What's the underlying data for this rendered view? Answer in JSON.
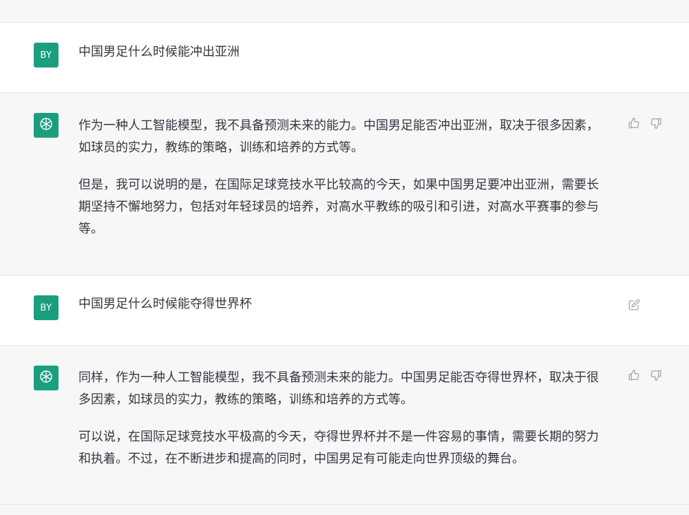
{
  "messages": [
    {
      "role": "user",
      "avatar_initials": "BY",
      "text": "中国男足什么时候能冲出亚洲"
    },
    {
      "role": "assistant",
      "paragraphs": [
        "作为一种人工智能模型，我不具备预测未来的能力。中国男足能否冲出亚洲，取决于很多因素，如球员的实力，教练的策略，训练和培养的方式等。",
        "但是，我可以说明的是，在国际足球竞技水平比较高的今天，如果中国男足要冲出亚洲，需要长期坚持不懈地努力，包括对年轻球员的培养，对高水平教练的吸引和引进，对高水平赛事的参与等。"
      ]
    },
    {
      "role": "user",
      "avatar_initials": "BY",
      "text": "中国男足什么时候能夺得世界杯"
    },
    {
      "role": "assistant",
      "paragraphs": [
        "同样，作为一种人工智能模型，我不具备预测未来的能力。中国男足能否夺得世界杯，取决于很多因素，如球员的实力，教练的策略，训练和培养的方式等。",
        "可以说，在国际足球竞技水平极高的今天，夺得世界杯并不是一件容易的事情，需要长期的努力和执着。不过，在不断进步和提高的同时，中国男足有可能走向世界顶级的舞台。"
      ]
    }
  ],
  "icons": {
    "assistant_avatar": "openai-logo-icon",
    "like": "thumbs-up-icon",
    "dislike": "thumbs-down-icon",
    "edit": "edit-icon"
  },
  "colors": {
    "avatar_bg": "#1a9e7e",
    "user_row_bg": "#ffffff",
    "assistant_row_bg": "#f7f7f8",
    "text": "#353740",
    "icon": "#a6a6b3"
  }
}
